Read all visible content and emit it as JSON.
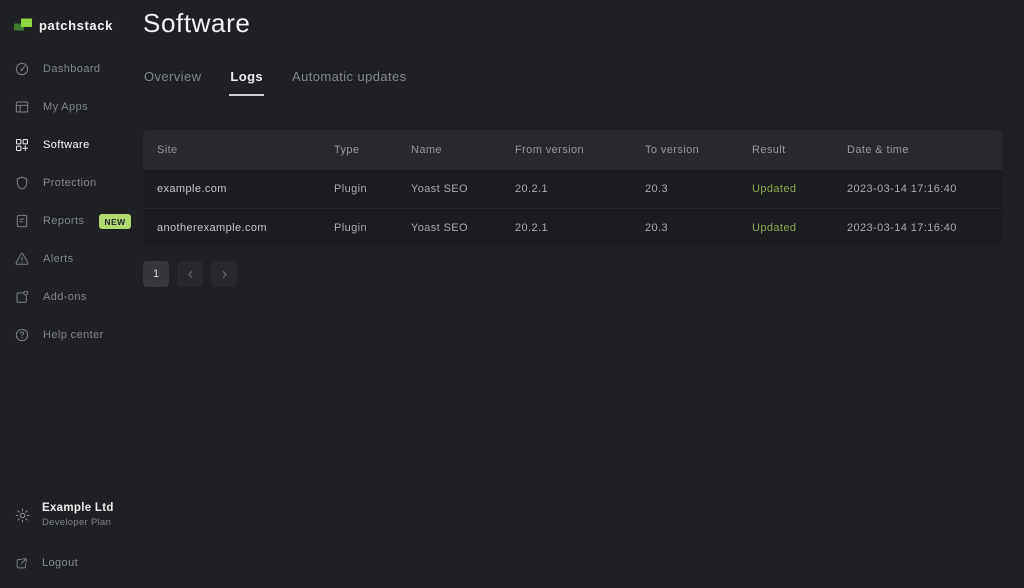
{
  "brand": {
    "name": "patchstack"
  },
  "sidebar": {
    "items": [
      {
        "label": "Dashboard",
        "icon": "dashboard",
        "active": false
      },
      {
        "label": "My Apps",
        "icon": "my-apps",
        "active": false
      },
      {
        "label": "Software",
        "icon": "software",
        "active": true
      },
      {
        "label": "Protection",
        "icon": "protection",
        "active": false
      },
      {
        "label": "Reports",
        "icon": "reports",
        "active": false,
        "badge": "NEW"
      },
      {
        "label": "Alerts",
        "icon": "alerts",
        "active": false
      },
      {
        "label": "Add-ons",
        "icon": "add-ons",
        "active": false
      },
      {
        "label": "Help center",
        "icon": "help",
        "active": false
      }
    ],
    "footer": {
      "org_name": "Example Ltd",
      "org_plan": "Developer Plan",
      "logout_label": "Logout"
    }
  },
  "header": {
    "title": "Software"
  },
  "tabs": [
    {
      "label": "Overview",
      "active": false
    },
    {
      "label": "Logs",
      "active": true
    },
    {
      "label": "Automatic updates",
      "active": false
    }
  ],
  "table": {
    "columns": {
      "site": "Site",
      "type": "Type",
      "name": "Name",
      "from_version": "From version",
      "to_version": "To version",
      "result": "Result",
      "datetime": "Date & time"
    },
    "rows": [
      {
        "site": "example.com",
        "type": "Plugin",
        "name": "Yoast SEO",
        "from_version": "20.2.1",
        "to_version": "20.3",
        "result": "Updated",
        "datetime": "2023-03-14 17:16:40"
      },
      {
        "site": "anotherexample.com",
        "type": "Plugin",
        "name": "Yoast SEO",
        "from_version": "20.2.1",
        "to_version": "20.3",
        "result": "Updated",
        "datetime": "2023-03-14 17:16:40"
      }
    ]
  },
  "pagination": {
    "current_page": "1"
  },
  "colors": {
    "bg": "#1e2024",
    "header-bg": "#27292d",
    "row-bg": "#1a1c1f",
    "status-green": "#8aab52",
    "badge-bg": "#b2d96d",
    "badge-text": "#20242a",
    "active-text": "#ffffff",
    "muted": "#83868b",
    "logo-green-bright": "#8fd641",
    "logo-green-dark": "#3e7a2d"
  }
}
